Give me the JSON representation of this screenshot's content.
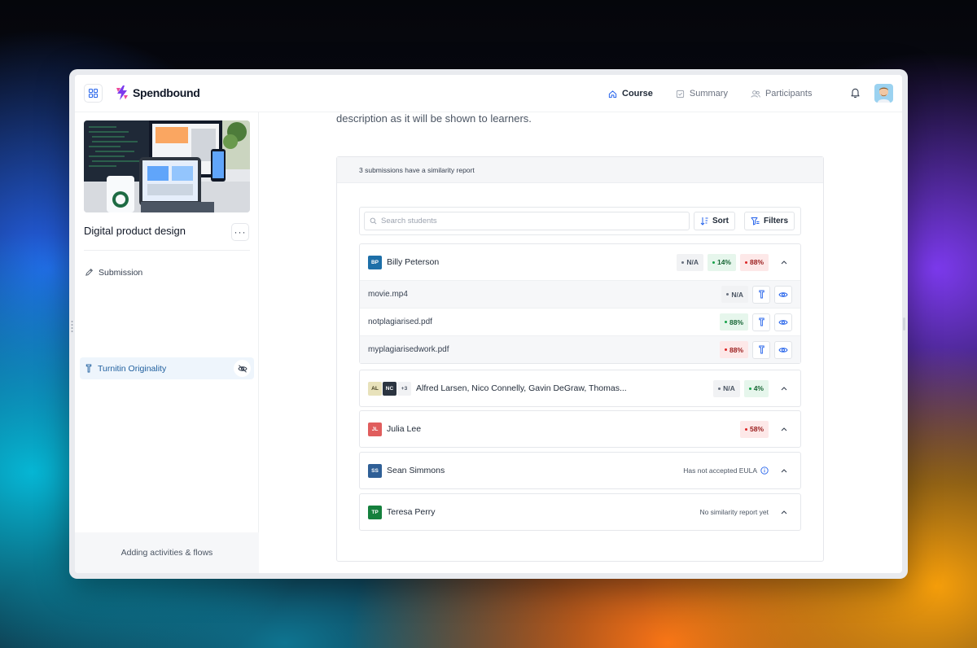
{
  "app": {
    "name": "Spendbound"
  },
  "nav": [
    {
      "label": "Course",
      "icon": "home-icon",
      "active": true
    },
    {
      "label": "Summary",
      "icon": "checklist-icon",
      "active": false
    },
    {
      "label": "Participants",
      "icon": "users-icon",
      "active": false
    }
  ],
  "sidebar": {
    "course_title": "Digital product design",
    "more_label": "···",
    "items": [
      {
        "label": "Submission",
        "icon": "pencil-icon",
        "active": false
      },
      {
        "label": "Turnitin Originality",
        "icon": "turnitin-icon",
        "active": true
      }
    ],
    "footer_label": "Adding activities & flows"
  },
  "main": {
    "description": "description as it will be shown to learners.",
    "panel_header": "3 submissions have a similarity report",
    "search": {
      "placeholder": "Search students"
    },
    "sort_label": "Sort",
    "filters_label": "Filters",
    "students": [
      {
        "initials": "BP",
        "name": "Billy Peterson",
        "color": "#1d6fa8",
        "expanded": true,
        "badges": [
          {
            "text": "N/A",
            "tone": "gray"
          },
          {
            "text": "14%",
            "tone": "green"
          },
          {
            "text": "88%",
            "tone": "red"
          }
        ],
        "files": [
          {
            "name": "movie.mp4",
            "badge": "N/A",
            "tone": "gray"
          },
          {
            "name": "notplagiarised.pdf",
            "badge": "88%",
            "tone": "green"
          },
          {
            "name": "myplagiarisedwork.pdf",
            "badge": "88%",
            "tone": "red"
          }
        ]
      },
      {
        "initials_group": [
          "AL",
          "NC"
        ],
        "extra_count": "+3",
        "name": "Alfred Larsen, Nico Connelly, Gavin DeGraw, Thomas...",
        "badges": [
          {
            "text": "N/A",
            "tone": "gray"
          },
          {
            "text": "4%",
            "tone": "green"
          }
        ]
      },
      {
        "initials": "JL",
        "name": "Julia Lee",
        "color": "#e05d5d",
        "badges": [
          {
            "text": "58%",
            "tone": "red"
          }
        ]
      },
      {
        "initials": "SS",
        "name": "Sean Simmons",
        "color": "#2f5f96",
        "status": "Has not accepted EULA"
      },
      {
        "initials": "TP",
        "name": "Teresa Perry",
        "color": "#15803d",
        "status": "No similarity report yet"
      }
    ]
  },
  "colors": {
    "accent": "#1f5f9e",
    "brand_pink": "#ec4899",
    "brand_purple": "#7c3aed"
  }
}
